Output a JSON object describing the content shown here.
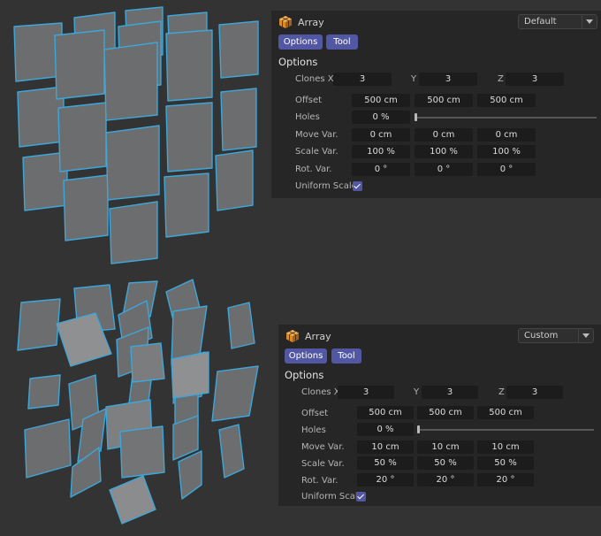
{
  "colors": {
    "background": "#333333",
    "panel": "#262626",
    "field": "#1c1c1c",
    "accent": "#5257a3",
    "clone_fill": "#6b6d6f",
    "clone_fill_light": "#8e9092",
    "clone_edge": "#3ea6d8"
  },
  "panels": [
    {
      "object_icon": "array-cube-icon",
      "object_name": "Array",
      "preset": "Default",
      "tabs": [
        "Options",
        "Tool"
      ],
      "section_title": "Options",
      "clones_label": "Clones X",
      "axis_y": "Y",
      "axis_z": "Z",
      "clones": [
        "3",
        "3",
        "3"
      ],
      "offset_label": "Offset",
      "offset": [
        "500 cm",
        "500 cm",
        "500 cm"
      ],
      "holes_label": "Holes",
      "holes": "0 %",
      "holes_fraction": 0.0,
      "move_label": "Move Var.",
      "move": [
        "0 cm",
        "0 cm",
        "0 cm"
      ],
      "scale_label": "Scale Var.",
      "scale": [
        "100 %",
        "100 %",
        "100 %"
      ],
      "rot_label": "Rot. Var.",
      "rot": [
        "0 °",
        "0 °",
        "0 °"
      ],
      "uniform_label": "Uniform Scale",
      "uniform_checked": true
    },
    {
      "object_icon": "array-cube-icon",
      "object_name": "Array",
      "preset": "Custom",
      "tabs": [
        "Options",
        "Tool"
      ],
      "section_title": "Options",
      "clones_label": "Clones X",
      "axis_y": "Y",
      "axis_z": "Z",
      "clones": [
        "3",
        "3",
        "3"
      ],
      "offset_label": "Offset",
      "offset": [
        "500 cm",
        "500 cm",
        "500 cm"
      ],
      "holes_label": "Holes",
      "holes": "0 %",
      "holes_fraction": 0.0,
      "move_label": "Move Var.",
      "move": [
        "10 cm",
        "10 cm",
        "10 cm"
      ],
      "scale_label": "Scale Var.",
      "scale": [
        "50 %",
        "50 %",
        "50 %"
      ],
      "rot_label": "Rot. Var.",
      "rot": [
        "20 °",
        "20 °",
        "20 °"
      ],
      "uniform_label": "Uniform Scale",
      "uniform_checked": true
    }
  ]
}
